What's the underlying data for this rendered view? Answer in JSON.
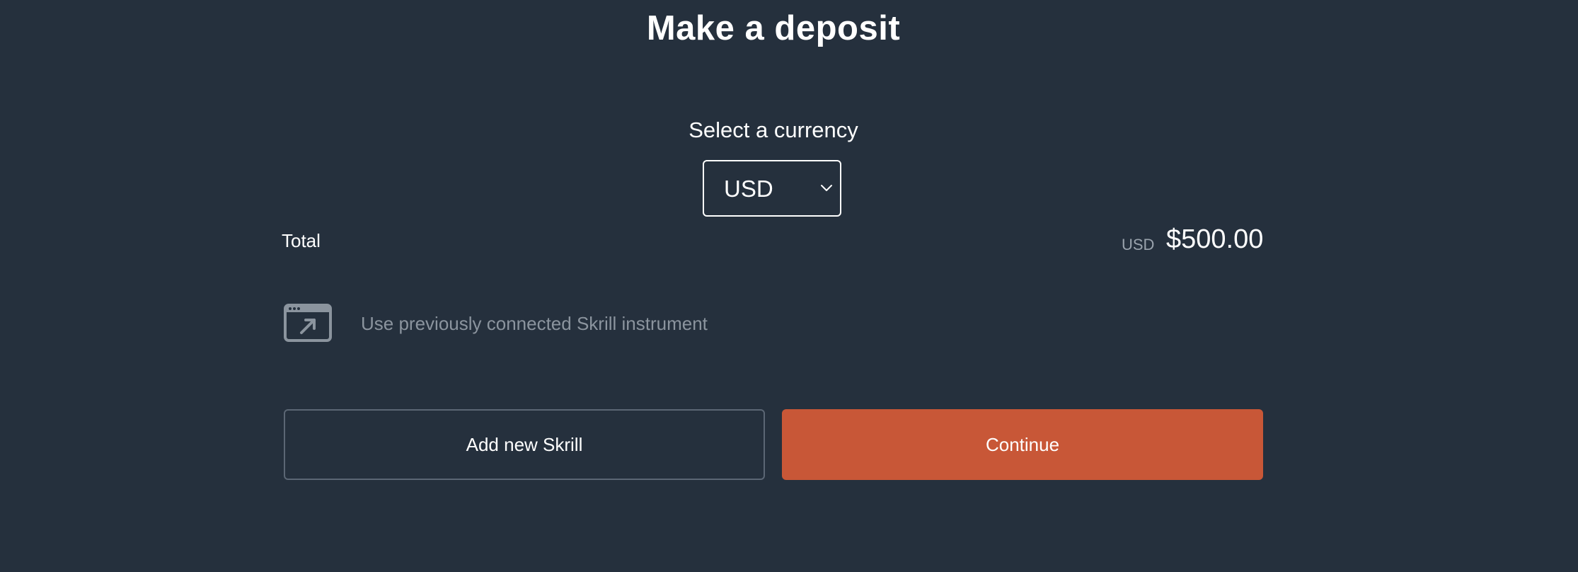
{
  "page": {
    "title": "Make a deposit"
  },
  "currency": {
    "label": "Select a currency",
    "selected": "USD",
    "chevron_icon": "chevron-down-icon"
  },
  "total": {
    "label": "Total",
    "currency": "USD",
    "amount": "$500.00"
  },
  "instrument": {
    "icon": "external-window-icon",
    "text": "Use previously connected Skrill instrument"
  },
  "actions": {
    "secondary_label": "Add new Skrill",
    "primary_label": "Continue"
  },
  "colors": {
    "background": "#25303d",
    "primary_button": "#c85737",
    "muted_text": "#8b949e",
    "secondary_border": "#5b6674"
  }
}
